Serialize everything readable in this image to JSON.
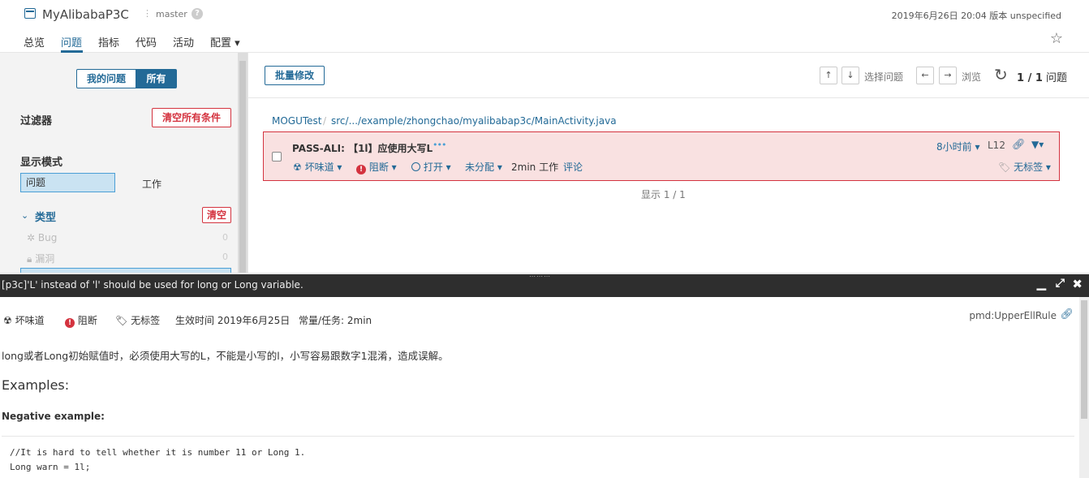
{
  "header": {
    "project_name": "MyAlibabaP3C",
    "branch": "master",
    "help": "?",
    "date_version": "2019年6月26日 20:04  版本 unspecified",
    "tabs": [
      {
        "label": "总览"
      },
      {
        "label": "问题"
      },
      {
        "label": "指标"
      },
      {
        "label": "代码"
      },
      {
        "label": "活动"
      },
      {
        "label": "配置 ▾"
      }
    ],
    "active_tab": "问题"
  },
  "sidebar": {
    "my_issues": "我的问题",
    "all": "所有",
    "filters_label": "过滤器",
    "clear_all": "清空所有条件",
    "display_mode_label": "显示模式",
    "mode_issues": "问题",
    "mode_effort": "工作",
    "type_label": "类型",
    "clear": "清空",
    "types": [
      {
        "label": "Bug",
        "count": "0"
      },
      {
        "label": "漏洞",
        "count": "0"
      }
    ]
  },
  "main": {
    "bulk_change": "批量修改",
    "nav_up": "↑",
    "nav_down": "↓",
    "select_issues": "选择问题",
    "nav_left": "←",
    "nav_right": "→",
    "browse": "浏览",
    "count_bold": "1 / 1",
    "count_label": "问题",
    "breadcrumb": {
      "project": "MOGUTest",
      "separator": "/",
      "path": "src/.../example/zhongchao/myalibabap3c/MainActivity.java"
    },
    "issue": {
      "message": "PASS-ALI: 【1l】应使用大写L",
      "more": "•••",
      "type": "坏味道",
      "severity": "阻断",
      "status": "打开",
      "assignee": "未分配",
      "effort": "2min 工作",
      "comment": "评论",
      "age": "8小时前",
      "line": "L12",
      "tags": "无标签"
    },
    "showing": "显示 1 / 1"
  },
  "detail": {
    "title": "[p3c]'L' instead of 'l' should be used for long or Long variable.",
    "type": "坏味道",
    "severity": "阻断",
    "tags": "无标签",
    "effective": "生效时间 2019年6月25日",
    "constant": "常量/任务: 2min",
    "rule_key": "pmd:UpperEllRule",
    "description": "long或者Long初始赋值时，必须使用大写的L，不能是小写的l，小写容易跟数字1混淆，造成误解。",
    "examples_heading": "Examples:",
    "negative_heading": "Negative example:",
    "code": "//It is hard to tell whether it is number 11 or Long 1.\nLong warn = 1l;"
  },
  "colors": {
    "accent": "#236a97",
    "danger": "#d4333f",
    "issue_bg": "#f9e1e1",
    "selected_bg": "#cae3f2",
    "dark_bar": "#2e2e2e"
  }
}
